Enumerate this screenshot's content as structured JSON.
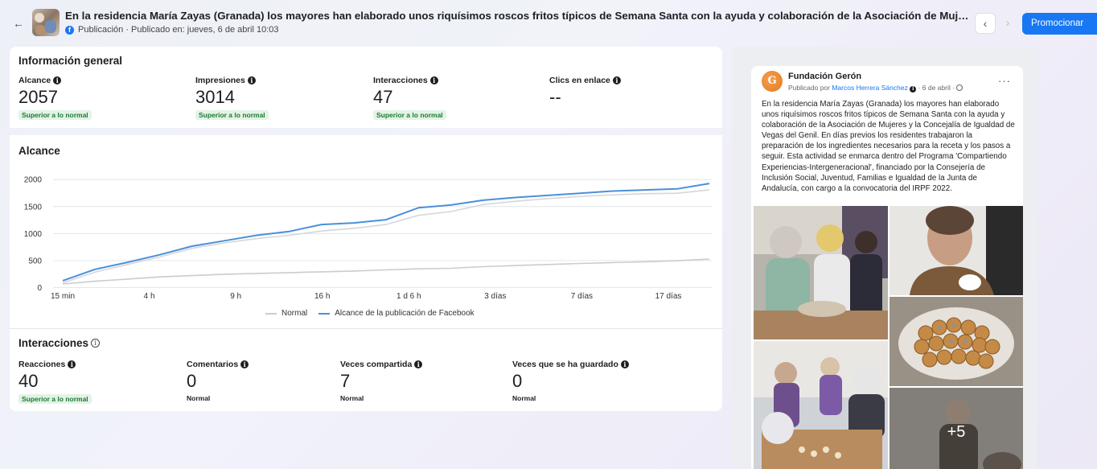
{
  "header": {
    "title": "En la residencia María Zayas (Granada) los mayores han elaborado unos riquísimos roscos fritos típicos de Semana Santa con la ayuda y colaboración de la Asociación de Mujeres y la Concejalía de Igualdad de Vegas del Geni...",
    "subtitle": "Publicación · Publicado en: jueves, 6 de abril 10:03",
    "back_icon": "arrow-left-icon",
    "prev_icon": "chevron-left-icon",
    "next_icon": "chevron-right-icon",
    "promote_label": "Promocionar"
  },
  "overview": {
    "title": "Información general",
    "metrics": [
      {
        "label": "Alcance",
        "value": "2057",
        "status": "Superior a lo normal"
      },
      {
        "label": "Impresiones",
        "value": "3014",
        "status": "Superior a lo normal"
      },
      {
        "label": "Interacciones",
        "value": "47",
        "status": "Superior a lo normal"
      },
      {
        "label": "Clics en enlace",
        "value": "--",
        "status": ""
      }
    ]
  },
  "reach_chart": {
    "title": "Alcance"
  },
  "chart_data": {
    "type": "line",
    "title": "Alcance",
    "x_labels": [
      "15 min",
      "4 h",
      "9 h",
      "16 h",
      "1 d 6 h",
      "3 días",
      "7 días",
      "17 días"
    ],
    "y_ticks": [
      0,
      500,
      1000,
      1500,
      2000
    ],
    "ylim": [
      0,
      2100
    ],
    "grid": true,
    "legend_position": "bottom-center",
    "series": [
      {
        "name": "Normal",
        "color": "#c9ccd1",
        "values": [
          60,
          110,
          150,
          190,
          215,
          240,
          255,
          270,
          285,
          300,
          320,
          340,
          350,
          380,
          400,
          420,
          440,
          455,
          470,
          490,
          520
        ]
      },
      {
        "name": "Alcance de la publicación de Facebook",
        "color": "#4a90d9",
        "values": [
          120,
          330,
          460,
          600,
          760,
          860,
          960,
          1030,
          1160,
          1190,
          1250,
          1470,
          1520,
          1610,
          1660,
          1700,
          1740,
          1780,
          1800,
          1820,
          1920
        ]
      },
      {
        "name": "",
        "color": "#d5d7db",
        "values": [
          80,
          280,
          420,
          560,
          720,
          820,
          900,
          960,
          1040,
          1090,
          1160,
          1330,
          1400,
          1530,
          1590,
          1640,
          1680,
          1710,
          1730,
          1740,
          1800
        ]
      }
    ]
  },
  "interactions": {
    "title": "Interacciones",
    "metrics": [
      {
        "label": "Reacciones",
        "value": "40",
        "status": "Superior a lo normal"
      },
      {
        "label": "Comentarios",
        "value": "0",
        "status": "Normal"
      },
      {
        "label": "Veces compartida",
        "value": "7",
        "status": "Normal"
      },
      {
        "label": "Veces que se ha guardado",
        "value": "0",
        "status": "Normal"
      }
    ]
  },
  "preview": {
    "page_name": "Fundación Gerón",
    "byline_prefix": "Publicado por ",
    "author": "Marcos Herrera Sánchez",
    "byline_suffix": " · 6 de abril · ",
    "more_label": "···",
    "text": "En la residencia María Zayas (Granada) los mayores han elaborado unos riquísimos roscos fritos típicos de Semana Santa con la ayuda y colaboración de la Asociación de Mujeres y la Concejalía de Igualdad de Vegas del Genil. En días previos los residentes trabajaron la preparación de los ingredientes necesarios para la receta y los pasos a seguir. Esta actividad se enmarca dentro del Programa 'Compartiendo Experiencias-Intergeneracional', financiado por la Consejería de Inclusión Social, Juventud, Familias e Igualdad de la Junta de Andalucía, con cargo a la convocatoria del IRPF 2022.",
    "more_photos": "+5"
  }
}
